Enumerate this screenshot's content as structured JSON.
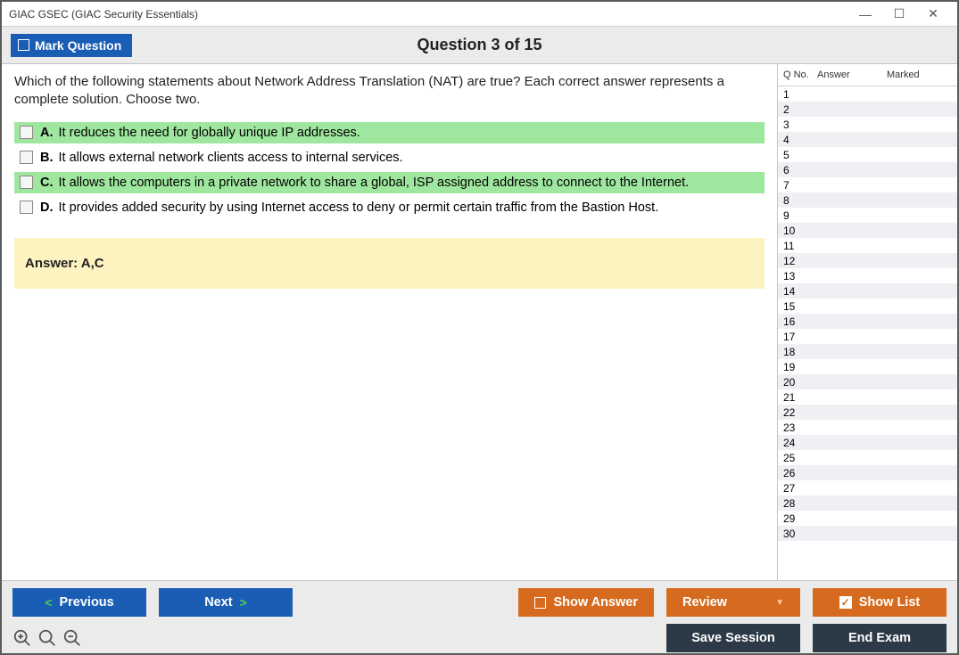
{
  "window": {
    "title": "GIAC GSEC (GIAC Security Essentials)"
  },
  "topbar": {
    "mark_label": "Mark Question",
    "question_title": "Question 3 of 15"
  },
  "question": {
    "text": "Which of the following statements about Network Address Translation (NAT) are true? Each correct answer represents a complete solution. Choose two.",
    "choices": [
      {
        "letter": "A.",
        "text": "It reduces the need for globally unique IP addresses.",
        "correct": true
      },
      {
        "letter": "B.",
        "text": "It allows external network clients access to internal services.",
        "correct": false
      },
      {
        "letter": "C.",
        "text": "It allows the computers in a private network to share a global, ISP assigned address to connect to the Internet.",
        "correct": true
      },
      {
        "letter": "D.",
        "text": "It provides added security by using Internet access to deny or permit certain traffic from the Bastion Host.",
        "correct": false
      }
    ],
    "answer_label": "Answer: A,C"
  },
  "sidebar": {
    "headers": {
      "qno": "Q No.",
      "answer": "Answer",
      "marked": "Marked"
    },
    "row_count": 30
  },
  "footer": {
    "previous": "Previous",
    "next": "Next",
    "show_answer": "Show Answer",
    "review": "Review",
    "show_list": "Show List",
    "save_session": "Save Session",
    "end_exam": "End Exam"
  }
}
